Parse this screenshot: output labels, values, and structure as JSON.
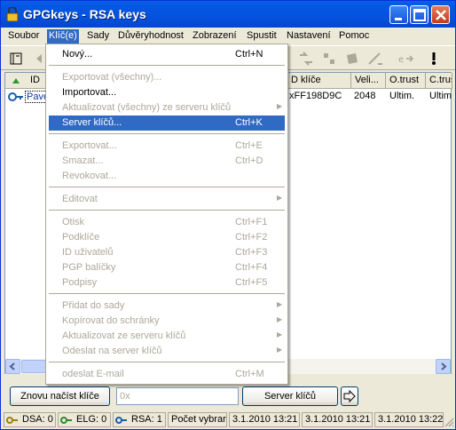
{
  "window": {
    "title": "GPGkeys - RSA keys"
  },
  "menubar": {
    "items": [
      "Soubor",
      "Klíč(e)",
      "Sady",
      "Důvěryhodnost",
      "Zobrazení",
      "Spustit",
      "Nastavení",
      "Pomoc"
    ],
    "active_index": 1
  },
  "list": {
    "headers": [
      "ID",
      "D klíče",
      "Veli...",
      "O.trust",
      "C.trust"
    ],
    "rows": [
      {
        "user": "Pave",
        "keyid": "xFF198D9C",
        "size": "2048",
        "otrust": "Ultim.",
        "ctrust": "Ultim"
      }
    ]
  },
  "keys_menu": {
    "items": [
      {
        "label": "Nový...",
        "shortcut": "Ctrl+N",
        "disabled": false
      },
      {
        "label": "Exportovat (všechny)...",
        "shortcut": "",
        "disabled": true
      },
      {
        "label": "Importovat...",
        "shortcut": "",
        "disabled": false
      },
      {
        "label": "Aktualizovat (všechny) ze serveru klíčů",
        "shortcut": "",
        "disabled": true,
        "submenu": true
      },
      {
        "label": "Server klíčů...",
        "shortcut": "Ctrl+K",
        "disabled": false,
        "highlighted": true
      },
      {
        "label": "Exportovat...",
        "shortcut": "Ctrl+E",
        "disabled": true
      },
      {
        "label": "Smazat...",
        "shortcut": "Ctrl+D",
        "disabled": true
      },
      {
        "label": "Revokovat...",
        "shortcut": "",
        "disabled": true
      },
      {
        "label": "Editovat",
        "shortcut": "",
        "disabled": true,
        "submenu": true
      },
      {
        "label": "Otisk",
        "shortcut": "Ctrl+F1",
        "disabled": true
      },
      {
        "label": "Podklíče",
        "shortcut": "Ctrl+F2",
        "disabled": true
      },
      {
        "label": "ID uživatelů",
        "shortcut": "Ctrl+F3",
        "disabled": true
      },
      {
        "label": "PGP balíčky",
        "shortcut": "Ctrl+F4",
        "disabled": true
      },
      {
        "label": "Podpisy",
        "shortcut": "Ctrl+F5",
        "disabled": true
      },
      {
        "label": "Přidat do sady",
        "shortcut": "",
        "disabled": true,
        "submenu": true
      },
      {
        "label": "Kopírovat do schránky",
        "shortcut": "",
        "disabled": true,
        "submenu": true
      },
      {
        "label": "Aktualizovat ze serveru klíčů",
        "shortcut": "",
        "disabled": true,
        "submenu": true
      },
      {
        "label": "Odeslat na server klíčů",
        "shortcut": "",
        "disabled": true,
        "submenu": true
      },
      {
        "label": "odeslat E-mail",
        "shortcut": "Ctrl+M",
        "disabled": true
      }
    ]
  },
  "bottom": {
    "reload_label": "Znovu načíst klíče",
    "search_placeholder": "0x",
    "server_label": "Server klíčů"
  },
  "status": {
    "dsa": "DSA: 0",
    "elg": "ELG: 0",
    "rsa": "RSA: 1",
    "count": "Počet vybrar",
    "date1": "3.1.2010 13:21",
    "date2": "3.1.2010 13:21",
    "date3": "3.1.2010 13:22"
  },
  "colors": {
    "selection": "#316ac5",
    "titlebar": "#0358e1",
    "face": "#ece9d8"
  }
}
